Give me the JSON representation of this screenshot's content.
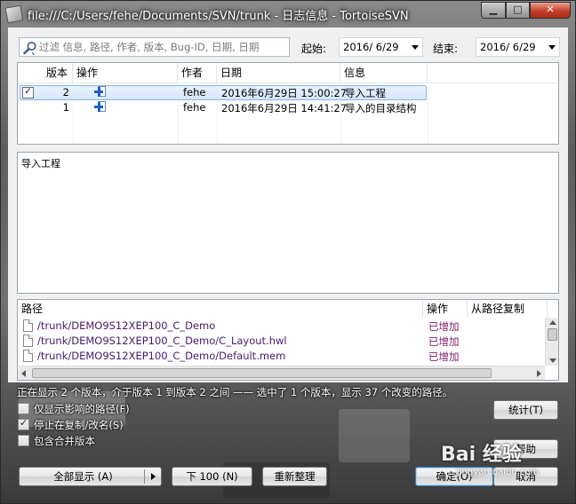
{
  "window": {
    "title": "file:///C:/Users/fehe/Documents/SVN/trunk - 日志信息 - TortoiseSVN",
    "min_label": "▁",
    "max_label": "□",
    "close_label": "✕"
  },
  "filter": {
    "placeholder": "过滤 信息, 路径, 作者, 版本, Bug-ID, 日期, 日期",
    "from_label": "起始:",
    "from_value": "2016/ 6/29",
    "to_label": "结束:",
    "to_value": "2016/ 6/29"
  },
  "log": {
    "columns": [
      "版本",
      "操作",
      "作者",
      "日期",
      "信息"
    ],
    "rows": [
      {
        "checked": true,
        "revision": "2",
        "author": "fehe",
        "date": "2016年6月29日 15:00:27",
        "message": "导入工程"
      },
      {
        "checked": false,
        "revision": "1",
        "author": "fehe",
        "date": "2016年6月29日 14:41:27",
        "message": "导入的目录结构"
      }
    ]
  },
  "message_text": "导入工程",
  "paths": {
    "columns": [
      "路径",
      "操作",
      "从路径复制"
    ],
    "rows": [
      {
        "path": "/trunk/DEMO9S12XEP100_C_Demo",
        "action": "已增加"
      },
      {
        "path": "/trunk/DEMO9S12XEP100_C_Demo/C_Layout.hwl",
        "action": "已增加"
      },
      {
        "path": "/trunk/DEMO9S12XEP100_C_Demo/Default.mem",
        "action": "已增加"
      }
    ]
  },
  "status_text": "正在显示 2 个版本，介于版本 1 到版本 2 之间 —— 选中了 1 个版本，显示 37 个改变的路径。",
  "options": [
    {
      "label": "仅显示影响的路径(F)",
      "checked": false
    },
    {
      "label": "停止在复制/改名(S)",
      "checked": true
    },
    {
      "label": "包含合并版本",
      "checked": false
    }
  ],
  "buttons": {
    "stats": "统计(T)",
    "help": "帮助",
    "show_all": "全部显示 (A)",
    "next100": "下 100 (N)",
    "refresh": "重新整理",
    "ok": "确定(O)",
    "cancel": "取消"
  },
  "watermark": {
    "text": "Bai 经验",
    "url": "jingyan.baidu.com"
  }
}
